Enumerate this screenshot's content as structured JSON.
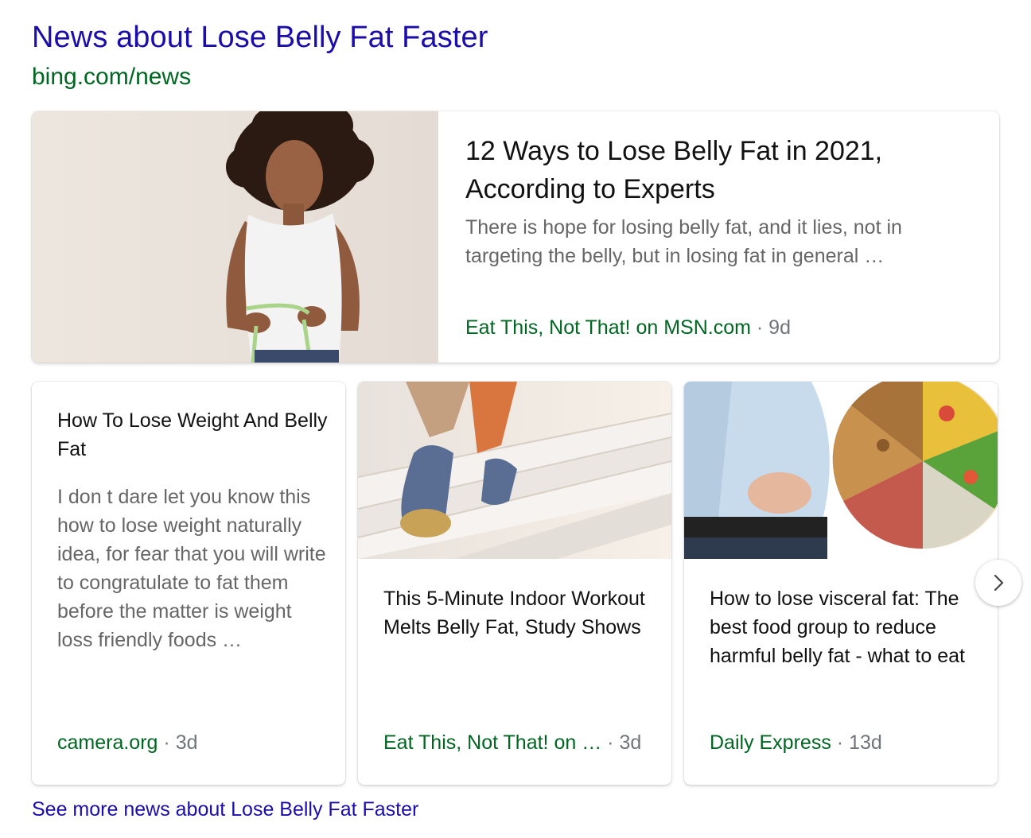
{
  "header": {
    "title": "News about Lose Belly Fat Faster",
    "source": "bing.com/news"
  },
  "featured": {
    "title": "12 Ways to Lose Belly Fat in 2021, According to Experts",
    "snippet": "There is hope for losing belly fat, and it lies, not in targeting the belly, but in losing fat in general …",
    "source": "Eat This, Not That! on MSN.com",
    "age": "9d"
  },
  "cards": [
    {
      "title": "How To Lose Weight And Belly Fat",
      "snippet": "I don t dare let you know this how to lose weight naturally idea, for fear that you will write to congratulate to fat them before the matter is weight loss friendly foods …",
      "source": "camera.org",
      "age": "3d"
    },
    {
      "title": "This 5-Minute Indoor Workout Melts Belly Fat, Study Shows",
      "source": "Eat This, Not That! on …",
      "age": "3d"
    },
    {
      "title": "How to lose visceral fat: The best food group to reduce harmful belly fat - what to eat",
      "source": "Daily Express",
      "age": "13d"
    }
  ],
  "separator": "·",
  "icons": {
    "next": "chevron-right-icon"
  },
  "footer": {
    "link": "See more news about Lose Belly Fat Faster"
  },
  "colors": {
    "link": "#1a0dab",
    "source": "#006621",
    "meta": "#70757a"
  }
}
